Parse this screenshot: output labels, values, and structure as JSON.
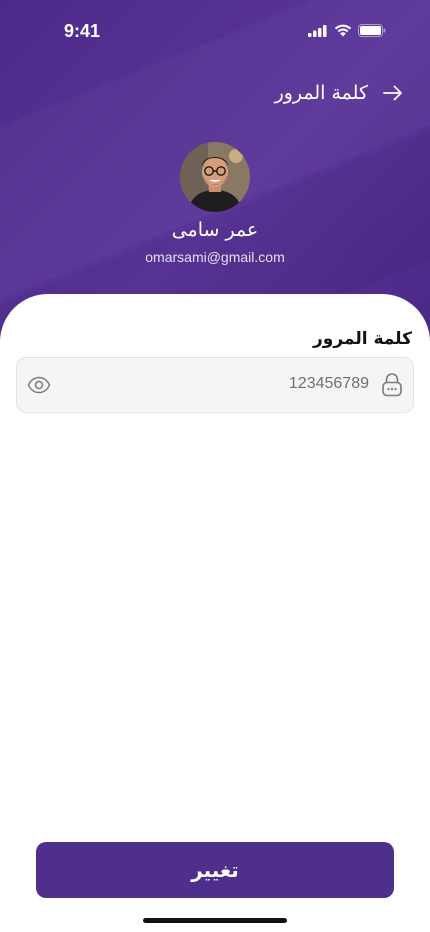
{
  "status_bar": {
    "time": "9:41",
    "icons": [
      "signal-icon",
      "wifi-icon",
      "battery-icon"
    ]
  },
  "header": {
    "title": "كلمة المرور",
    "back_icon": "arrow-right-icon"
  },
  "profile": {
    "name": "عمر سامى",
    "email": "omarsami@gmail.com"
  },
  "password_field": {
    "label": "كلمة المرور",
    "value": "123456789",
    "lock_icon": "lock-icon",
    "toggle_icon": "eye-icon"
  },
  "actions": {
    "change_label": "تغيير"
  },
  "colors": {
    "primary": "#4f2f8c",
    "header_bg": "#52308f",
    "field_bg": "#f5f5f5"
  }
}
